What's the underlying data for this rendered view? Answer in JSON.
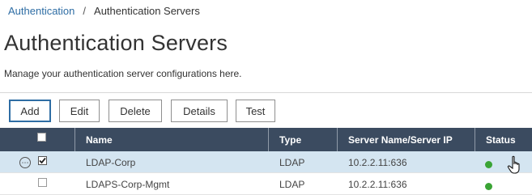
{
  "breadcrumb": {
    "parent": "Authentication",
    "separator": "/",
    "current": "Authentication Servers"
  },
  "page": {
    "title": "Authentication Servers",
    "description": "Manage your authentication server configurations here."
  },
  "toolbar": {
    "add": "Add",
    "edit": "Edit",
    "delete": "Delete",
    "details": "Details",
    "test": "Test"
  },
  "table": {
    "columns": {
      "name": "Name",
      "type": "Type",
      "server": "Server Name/Server IP",
      "status": "Status"
    },
    "rows": [
      {
        "name": "LDAP-Corp",
        "type": "LDAP",
        "server": "10.2.2.11:636",
        "selected": true,
        "status_color": "#3aa435"
      },
      {
        "name": "LDAPS-Corp-Mgmt",
        "type": "LDAP",
        "server": "10.2.2.11:636",
        "selected": false,
        "status_color": "#3aa435"
      }
    ]
  },
  "colors": {
    "header_bg": "#3b4b60",
    "selected_row_bg": "#d4e5f1",
    "link": "#2e6da4",
    "status_up": "#3aa435"
  },
  "icons": {
    "row_menu": "more-options-icon",
    "status": "status-dot-icon",
    "cursor": "hand-pointer-icon"
  }
}
